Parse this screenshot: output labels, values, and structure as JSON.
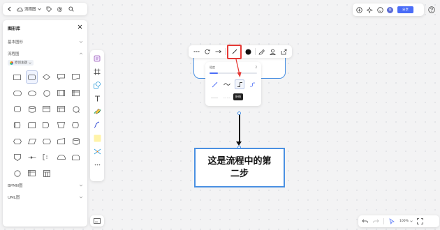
{
  "topbar": {
    "doc_label": "流程图"
  },
  "sidebar": {
    "title": "图形库",
    "sections": {
      "basic": "基本图形",
      "flowchart": "流程图",
      "bpmn": "BPMN图",
      "uml": "UML图"
    },
    "theme_chip": "原创主题"
  },
  "popup": {
    "width_label": "粗度",
    "width_value": "2",
    "width_level": 0.18
  },
  "tooltip": "折线",
  "canvas": {
    "step_text": "这是流程中的第二步"
  },
  "topright": {
    "avatar": "张",
    "share_label": "分享"
  },
  "zoom": {
    "value": "100%"
  },
  "colors": {
    "accent": "#4a6cf7",
    "shape_border": "#4a90e2",
    "highlight": "#e53935"
  }
}
